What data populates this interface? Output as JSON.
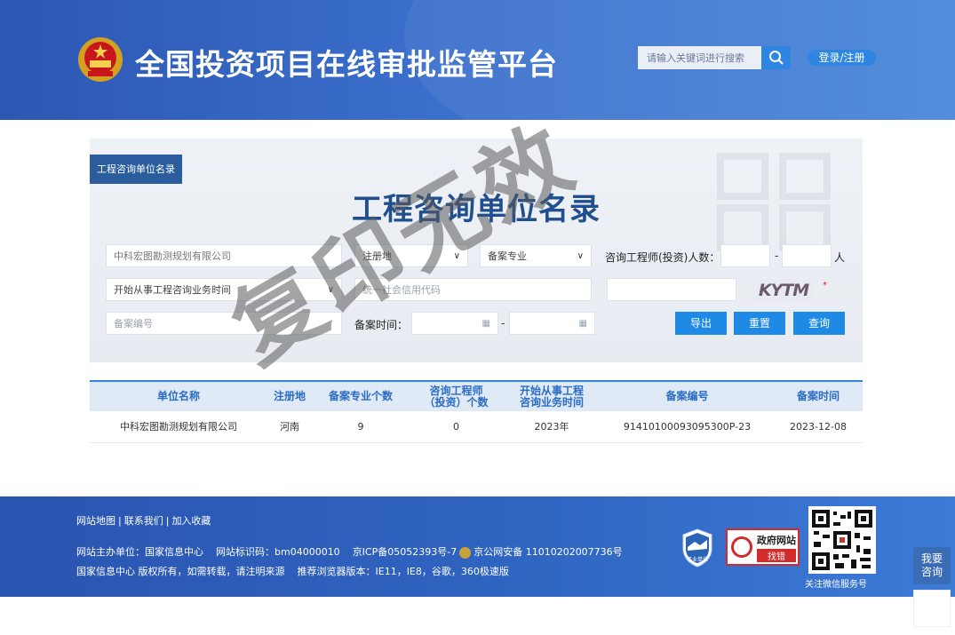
{
  "header": {
    "site_title": "全国投资项目在线审批监管平台",
    "search_placeholder": "请输入关键词进行搜索",
    "login_label": "登录/注册"
  },
  "panel": {
    "tag": "工程咨询单位名录",
    "title": "工程咨询单位名录",
    "company_name_value": "中科宏图勘测规划有限公司",
    "registration_select": "注册地",
    "specialty_select": "备案专业",
    "engineer_count_label": "咨询工程师(投资)人数：",
    "engineer_unit": "人",
    "range_dash": "-",
    "start_time_select": "开始从事工程咨询业务时间",
    "credit_code_placeholder": "统一社会信用代码",
    "captcha_text": "KYTM",
    "required_mark": "*",
    "record_number_placeholder": "备案编号",
    "record_time_label": "备案时间：",
    "buttons": {
      "export": "导出",
      "reset": "重置",
      "query": "查询"
    }
  },
  "table": {
    "headers": [
      "单位名称",
      "注册地",
      "备案专业个数",
      "咨询工程师\n（投资）个数",
      "开始从事工程\n咨询业务时间",
      "备案编号",
      "备案时间"
    ],
    "rows": [
      [
        "中科宏图勘测规划有限公司",
        "河南",
        "9",
        "0",
        "2023年",
        "91410100093095300P-23",
        "2023-12-08"
      ]
    ]
  },
  "watermark": "复印无效",
  "footer": {
    "links": [
      "网站地图",
      "联系我们",
      "加入收藏"
    ],
    "link_separator": "|",
    "line1_host": "网站主办单位：国家信息中心",
    "line1_id": "网站标识码：bm04000010",
    "line1_icp": "京ICP备05052393号-7",
    "line1_police": "京公网安备 11010202007736号",
    "line2_copyright": "国家信息中心 版权所有，如需转载，请注明来源",
    "line2_browser": "推荐浏览器版本：IE11，IE8，谷歌，360极速版",
    "badge_shiye": "事业单位",
    "badge_zhaocuo_top": "政府网站",
    "badge_zhaocuo_bottom": "找错",
    "qr_caption": "关注微信服务号"
  },
  "consult": {
    "line1": "我要",
    "line2": "咨询"
  },
  "colors": {
    "header_blue": "#2c57b3",
    "button_blue": "#1e8ae6",
    "title_blue": "#1f4f8f"
  }
}
